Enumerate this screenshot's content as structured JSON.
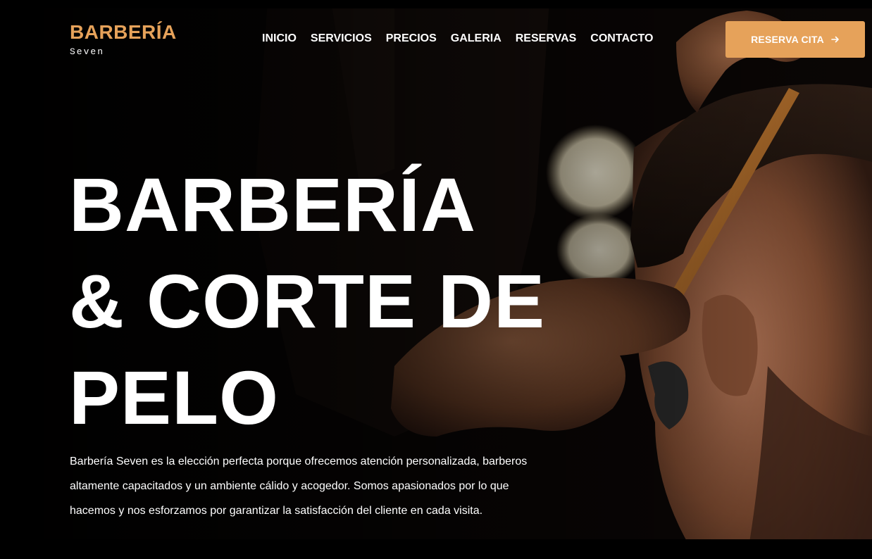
{
  "header": {
    "logo_title": "BARBERÍA",
    "logo_subtitle": "Seven",
    "nav": [
      {
        "label": "INICIO"
      },
      {
        "label": "SERVICIOS"
      },
      {
        "label": "PRECIOS"
      },
      {
        "label": "GALERIA"
      },
      {
        "label": "RESERVAS"
      },
      {
        "label": "CONTACTO"
      }
    ],
    "cta_label": "RESERVA CITA",
    "cta_icon": "arrow-right-icon"
  },
  "hero": {
    "headline_lines": [
      "BARBERÍA",
      "& CORTE DE",
      "PELO"
    ],
    "description": "Barbería Seven es la elección perfecta porque ofrecemos atención personalizada, barberos altamente capacitados y un ambiente cálido y acogedor. Somos apasionados por lo que hacemos y nos esforzamos por garantizar la satisfacción del cliente en cada visita."
  },
  "colors": {
    "accent": "#e6a25a",
    "background": "#000000",
    "text": "#ffffff"
  }
}
